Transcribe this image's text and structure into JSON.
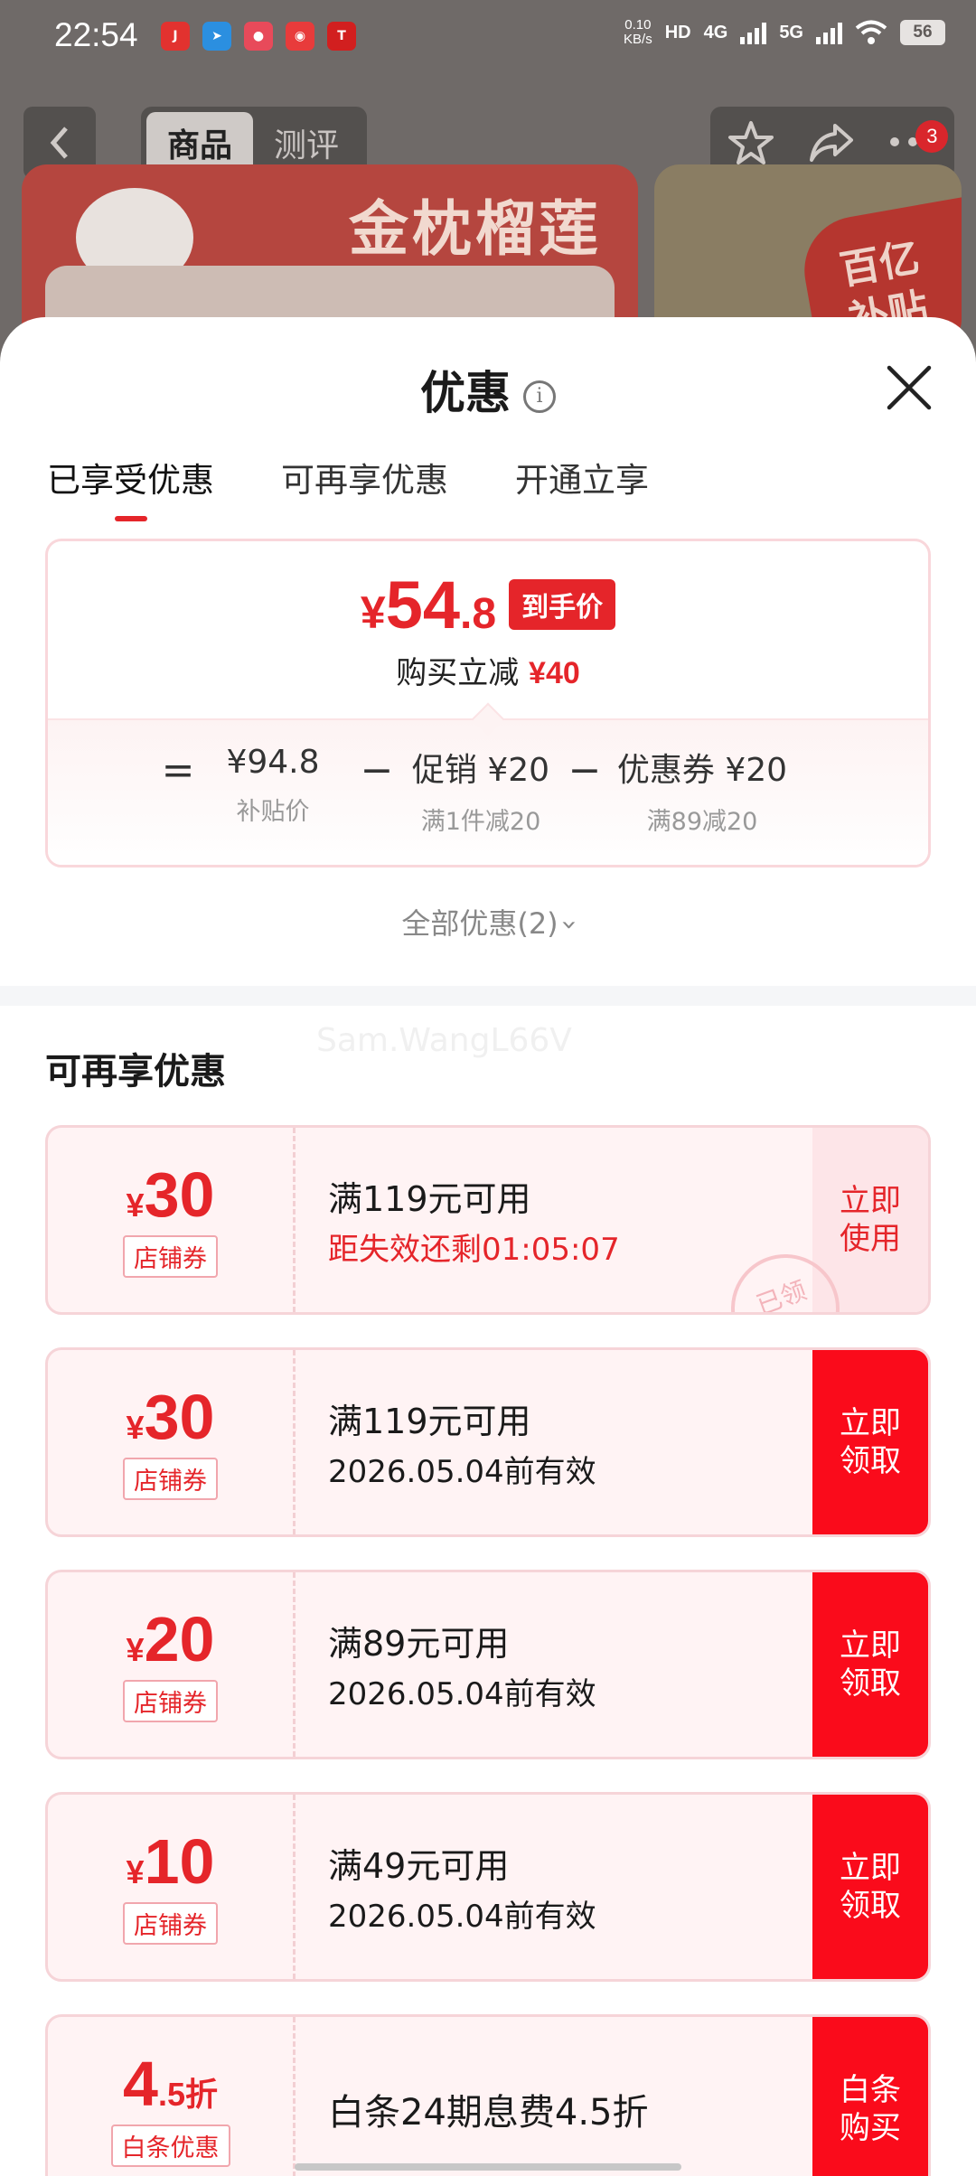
{
  "status_bar": {
    "time": "22:54",
    "net_speed_value": "0.10",
    "net_speed_unit": "KB/s",
    "hd": "HD",
    "sig1": "4G",
    "sig2": "5G",
    "battery": "56",
    "app_icons": [
      "jd-app-icon",
      "telegram-icon",
      "app-icon",
      "app-icon",
      "tmall-icon"
    ]
  },
  "nav": {
    "tabs": [
      "商品",
      "测评"
    ],
    "cart_badge": "3"
  },
  "banner": {
    "title": "金枕榴莲",
    "side_label": "百亿\n补贴"
  },
  "sheet": {
    "title": "优惠",
    "tabs": [
      "已享受优惠",
      "可再享优惠",
      "开通立享"
    ],
    "summary": {
      "currency": "¥",
      "price_int": "54",
      "price_dec": ".8",
      "final_tag": "到手价",
      "reduce_label": "购买立减",
      "reduce_value": "¥40",
      "formula": {
        "eq": "=",
        "minus": "−",
        "subsidy_price": "¥94.8",
        "subsidy_label": "补贴价",
        "promo_value": "促销 ¥20",
        "promo_label": "满1件减20",
        "coupon_value": "优惠券 ¥20",
        "coupon_label": "满89减20"
      }
    },
    "all_promos": "全部优惠(2)",
    "watermark": "Sam.WangL66V",
    "section_title": "可再享优惠",
    "coupons": [
      {
        "symbol": "¥",
        "amount": "30",
        "tag": "店铺券",
        "condition": "满119元可用",
        "validity": "距失效还剩01:05:07",
        "button": "立即\n使用",
        "stamp": "已领"
      },
      {
        "symbol": "¥",
        "amount": "30",
        "tag": "店铺券",
        "condition": "满119元可用",
        "validity": "2026.05.04前有效",
        "button": "立即\n领取"
      },
      {
        "symbol": "¥",
        "amount": "20",
        "tag": "店铺券",
        "condition": "满89元可用",
        "validity": "2026.05.04前有效",
        "button": "立即\n领取"
      },
      {
        "symbol": "¥",
        "amount": "10",
        "tag": "店铺券",
        "condition": "满49元可用",
        "validity": "2026.05.04前有效",
        "button": "立即\n领取"
      },
      {
        "amount": "4",
        "decimal": ".5折",
        "tag": "白条优惠",
        "condition": "白条24期息费4.5折",
        "button": "白条\n购买"
      }
    ]
  },
  "colors": {
    "accent": "#e5252a",
    "button": "#fa0b1b",
    "coupon_bg": "#fff3f4"
  }
}
